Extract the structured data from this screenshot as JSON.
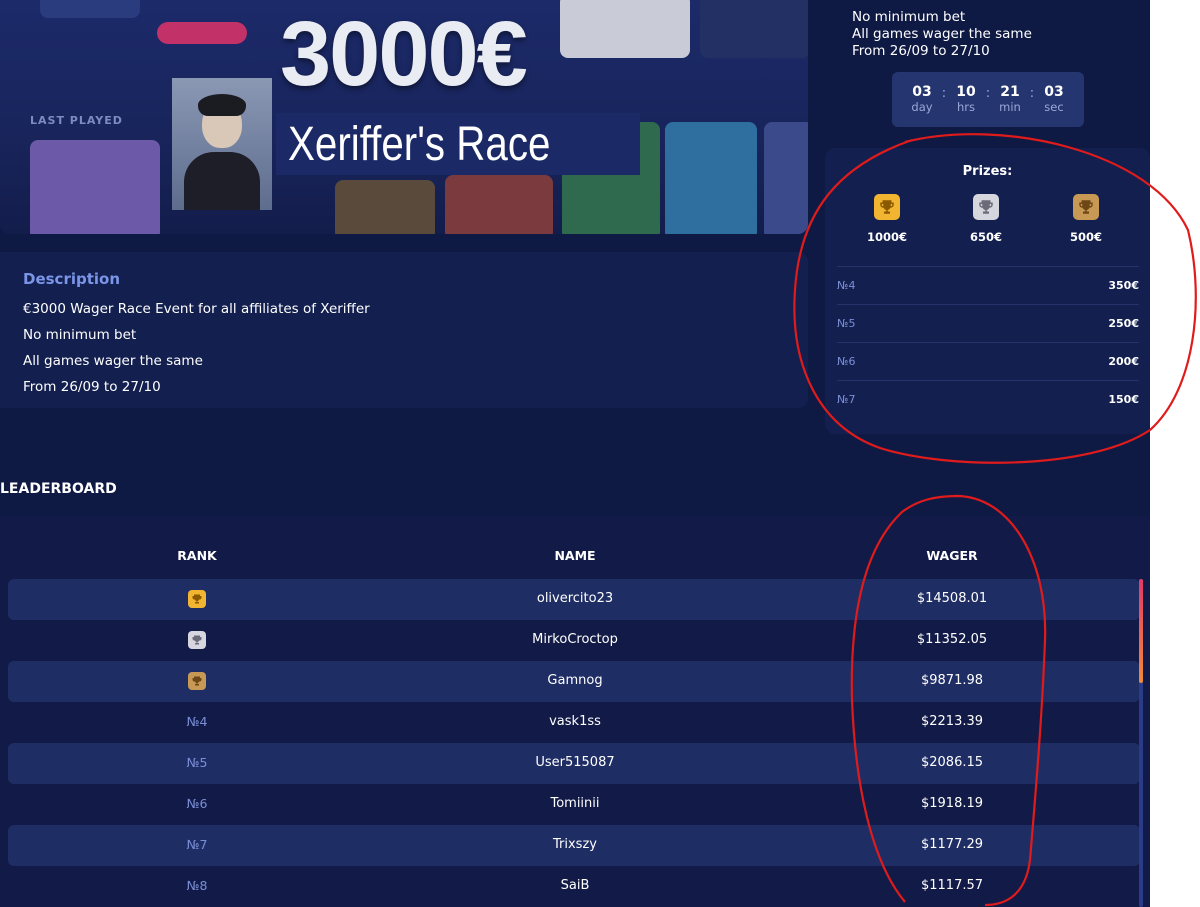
{
  "banner": {
    "amount": "3000€",
    "title": "Xeriffer's Race",
    "last_players_label": "LAST PLAYED"
  },
  "description": {
    "heading": "Description",
    "lines": [
      "€3000 Wager Race Event for all affiliates of Xeriffer",
      "No minimum bet",
      "All games wager the same",
      "From 26/09 to 27/10"
    ]
  },
  "side": {
    "info_lines": [
      "No minimum bet",
      "All games wager the same",
      "From 26/09 to 27/10"
    ],
    "countdown": [
      {
        "value": "03",
        "label": "day"
      },
      {
        "value": "10",
        "label": "hrs"
      },
      {
        "value": "21",
        "label": "min"
      },
      {
        "value": "03",
        "label": "sec"
      }
    ],
    "countdown_separator": ":",
    "prizes_heading": "Prizes:",
    "podium": [
      {
        "place": "gold",
        "amount": "1000€",
        "icon": "trophy-icon"
      },
      {
        "place": "silver",
        "amount": "650€",
        "icon": "trophy-icon"
      },
      {
        "place": "bronze",
        "amount": "500€",
        "icon": "trophy-icon"
      }
    ],
    "prize_rows": [
      {
        "rank": "№4",
        "amount": "350€"
      },
      {
        "rank": "№5",
        "amount": "250€"
      },
      {
        "rank": "№6",
        "amount": "200€"
      },
      {
        "rank": "№7",
        "amount": "150€"
      }
    ]
  },
  "leaderboard": {
    "title": "LEADERBOARD",
    "columns": {
      "rank": "RANK",
      "name": "NAME",
      "wager": "WAGER"
    },
    "rows": [
      {
        "rank": "",
        "trophy": "gold",
        "name": "olivercito23",
        "wager": "$14508.01"
      },
      {
        "rank": "",
        "trophy": "silver",
        "name": "MirkoCroctop",
        "wager": "$11352.05"
      },
      {
        "rank": "",
        "trophy": "bronze",
        "name": "Gamnog",
        "wager": "$9871.98"
      },
      {
        "rank": "№4",
        "trophy": "",
        "name": "vask1ss",
        "wager": "$2213.39"
      },
      {
        "rank": "№5",
        "trophy": "",
        "name": "User515087",
        "wager": "$2086.15"
      },
      {
        "rank": "№6",
        "trophy": "",
        "name": "Tomiinii",
        "wager": "$1918.19"
      },
      {
        "rank": "№7",
        "trophy": "",
        "name": "Trixszy",
        "wager": "$1177.29"
      },
      {
        "rank": "№8",
        "trophy": "",
        "name": "SaiB",
        "wager": "$1117.57"
      }
    ]
  },
  "colors": {
    "background": "#0f1a44",
    "card": "#131f4f",
    "accent": "#7b95e8",
    "gold": "#f2b531",
    "silver": "#d6d6de",
    "bronze": "#c79954",
    "annotation": "#e01b1b"
  }
}
